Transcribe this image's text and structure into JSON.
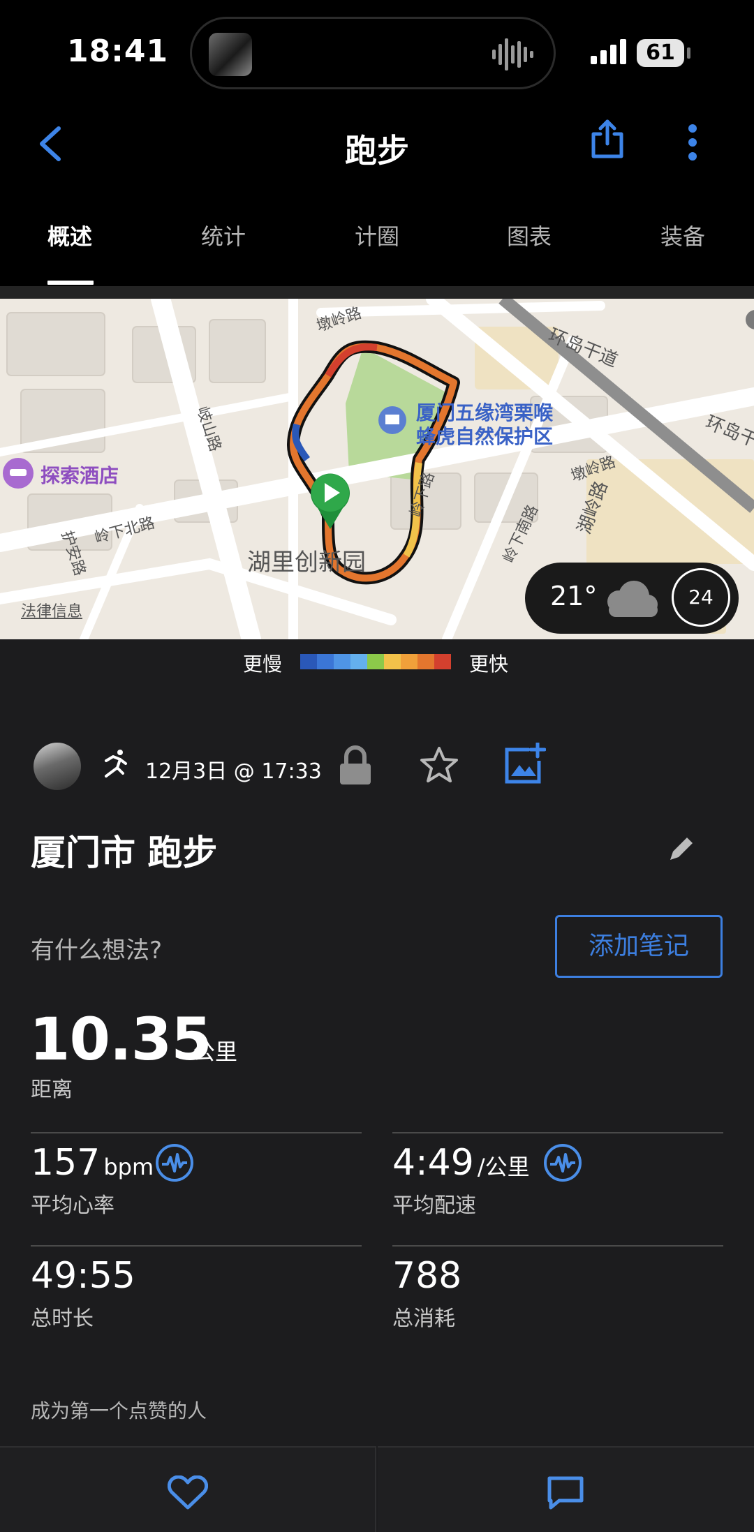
{
  "status": {
    "time": "18:41",
    "battery": "61"
  },
  "nav": {
    "title": "跑步"
  },
  "tabs": [
    {
      "label": "概述",
      "active": true
    },
    {
      "label": "统计"
    },
    {
      "label": "计圈"
    },
    {
      "label": "图表"
    },
    {
      "label": "装备"
    }
  ],
  "map": {
    "labels": {
      "dunling_road": "墩岭路",
      "huandao_road": "环岛干道",
      "huandao_road_2": "环岛干",
      "reserve_line1": "厦门五缘湾栗喉",
      "reserve_line2": "蜂虎自然保护区",
      "hotel": "探索酒店",
      "qishan_road": "岐山路",
      "lingxiabei_road": "岭下北路",
      "hu_an_road": "护安路",
      "huli_park": "湖里创新园",
      "lingxia_road": "岭下路",
      "lingxianan_road": "岭下南路",
      "wuling_road": "湖岭路",
      "dunling_road_2": "墩岭路",
      "legal": "法律信息"
    },
    "weather": {
      "temp": "21°",
      "wind": "24"
    }
  },
  "legend": {
    "slow": "更慢",
    "fast": "更快",
    "colors": [
      "#2a58b8",
      "#3b76d6",
      "#4f95e6",
      "#64b0ee",
      "#8cc94a",
      "#f2c24a",
      "#f0a03a",
      "#e3762e",
      "#d3402e"
    ]
  },
  "activity": {
    "date": "12月3日 @ 17:33",
    "title": "厦门市 跑步",
    "prompt": "有什么想法?",
    "add_note": "添加笔记",
    "distance": {
      "value": "10.35",
      "unit": "公里",
      "label": "距离"
    },
    "heart_rate": {
      "value": "157",
      "unit": "bpm",
      "label": "平均心率"
    },
    "pace": {
      "value": "4:49",
      "unit": "/公里",
      "label": "平均配速"
    },
    "duration": {
      "value": "49:55",
      "label": "总时长"
    },
    "calories": {
      "value": "788",
      "label": "总消耗"
    },
    "likes_text": "成为第一个点赞的人"
  }
}
